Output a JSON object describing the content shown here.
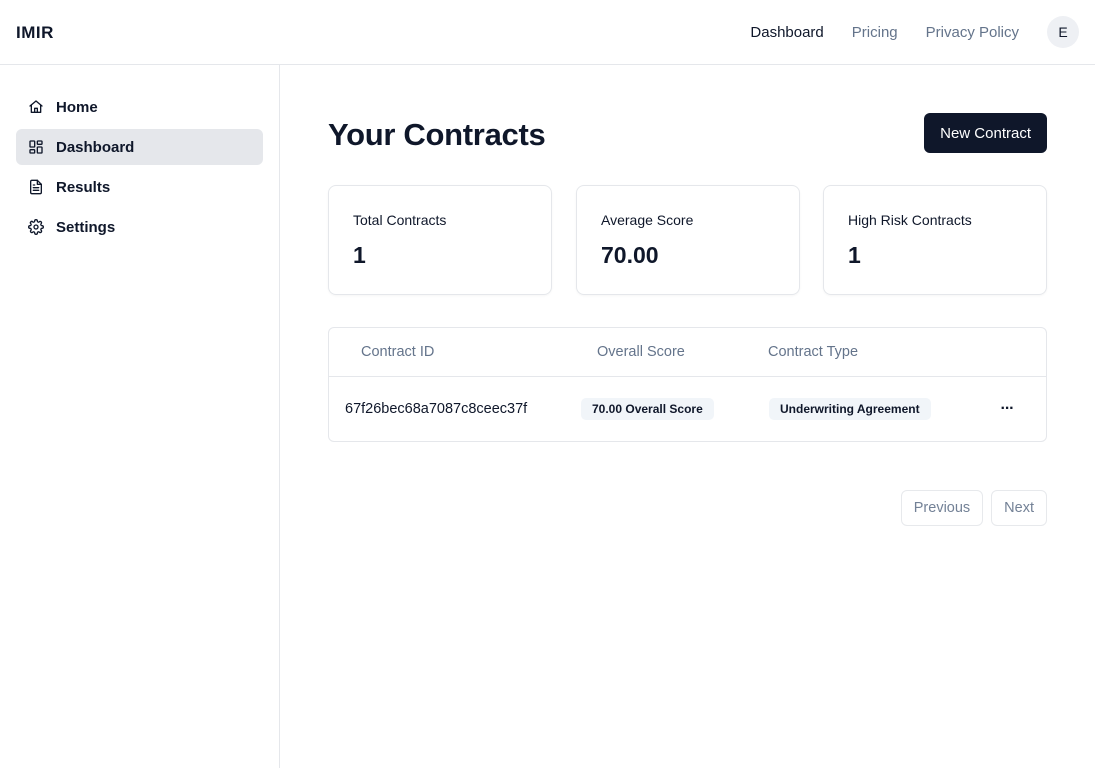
{
  "app": {
    "brand": "IMIR"
  },
  "topnav": {
    "items": [
      {
        "label": "Dashboard",
        "active": true
      },
      {
        "label": "Pricing",
        "active": false
      },
      {
        "label": "Privacy Policy",
        "active": false
      }
    ],
    "avatar_initial": "E"
  },
  "sidebar": {
    "items": [
      {
        "label": "Home",
        "icon": "home-icon"
      },
      {
        "label": "Dashboard",
        "icon": "dashboard-icon",
        "active": true
      },
      {
        "label": "Results",
        "icon": "file-text-icon"
      },
      {
        "label": "Settings",
        "icon": "gear-icon"
      }
    ]
  },
  "main": {
    "title": "Your Contracts",
    "new_button": "New Contract",
    "stats": [
      {
        "label": "Total Contracts",
        "value": "1"
      },
      {
        "label": "Average Score",
        "value": "70.00"
      },
      {
        "label": "High Risk Contracts",
        "value": "1"
      }
    ],
    "table": {
      "columns": [
        "Contract ID",
        "Overall Score",
        "Contract Type"
      ],
      "rows": [
        {
          "id": "67f26bec68a7087c8ceec37f",
          "score": "70.00 Overall Score",
          "type": "Underwriting Agreement"
        }
      ]
    },
    "pagination": {
      "previous": "Previous",
      "next": "Next"
    }
  },
  "colors": {
    "primary": "#0f172a",
    "muted": "#64748b",
    "border": "#e5e7eb",
    "active_bg": "#e5e7eb"
  }
}
